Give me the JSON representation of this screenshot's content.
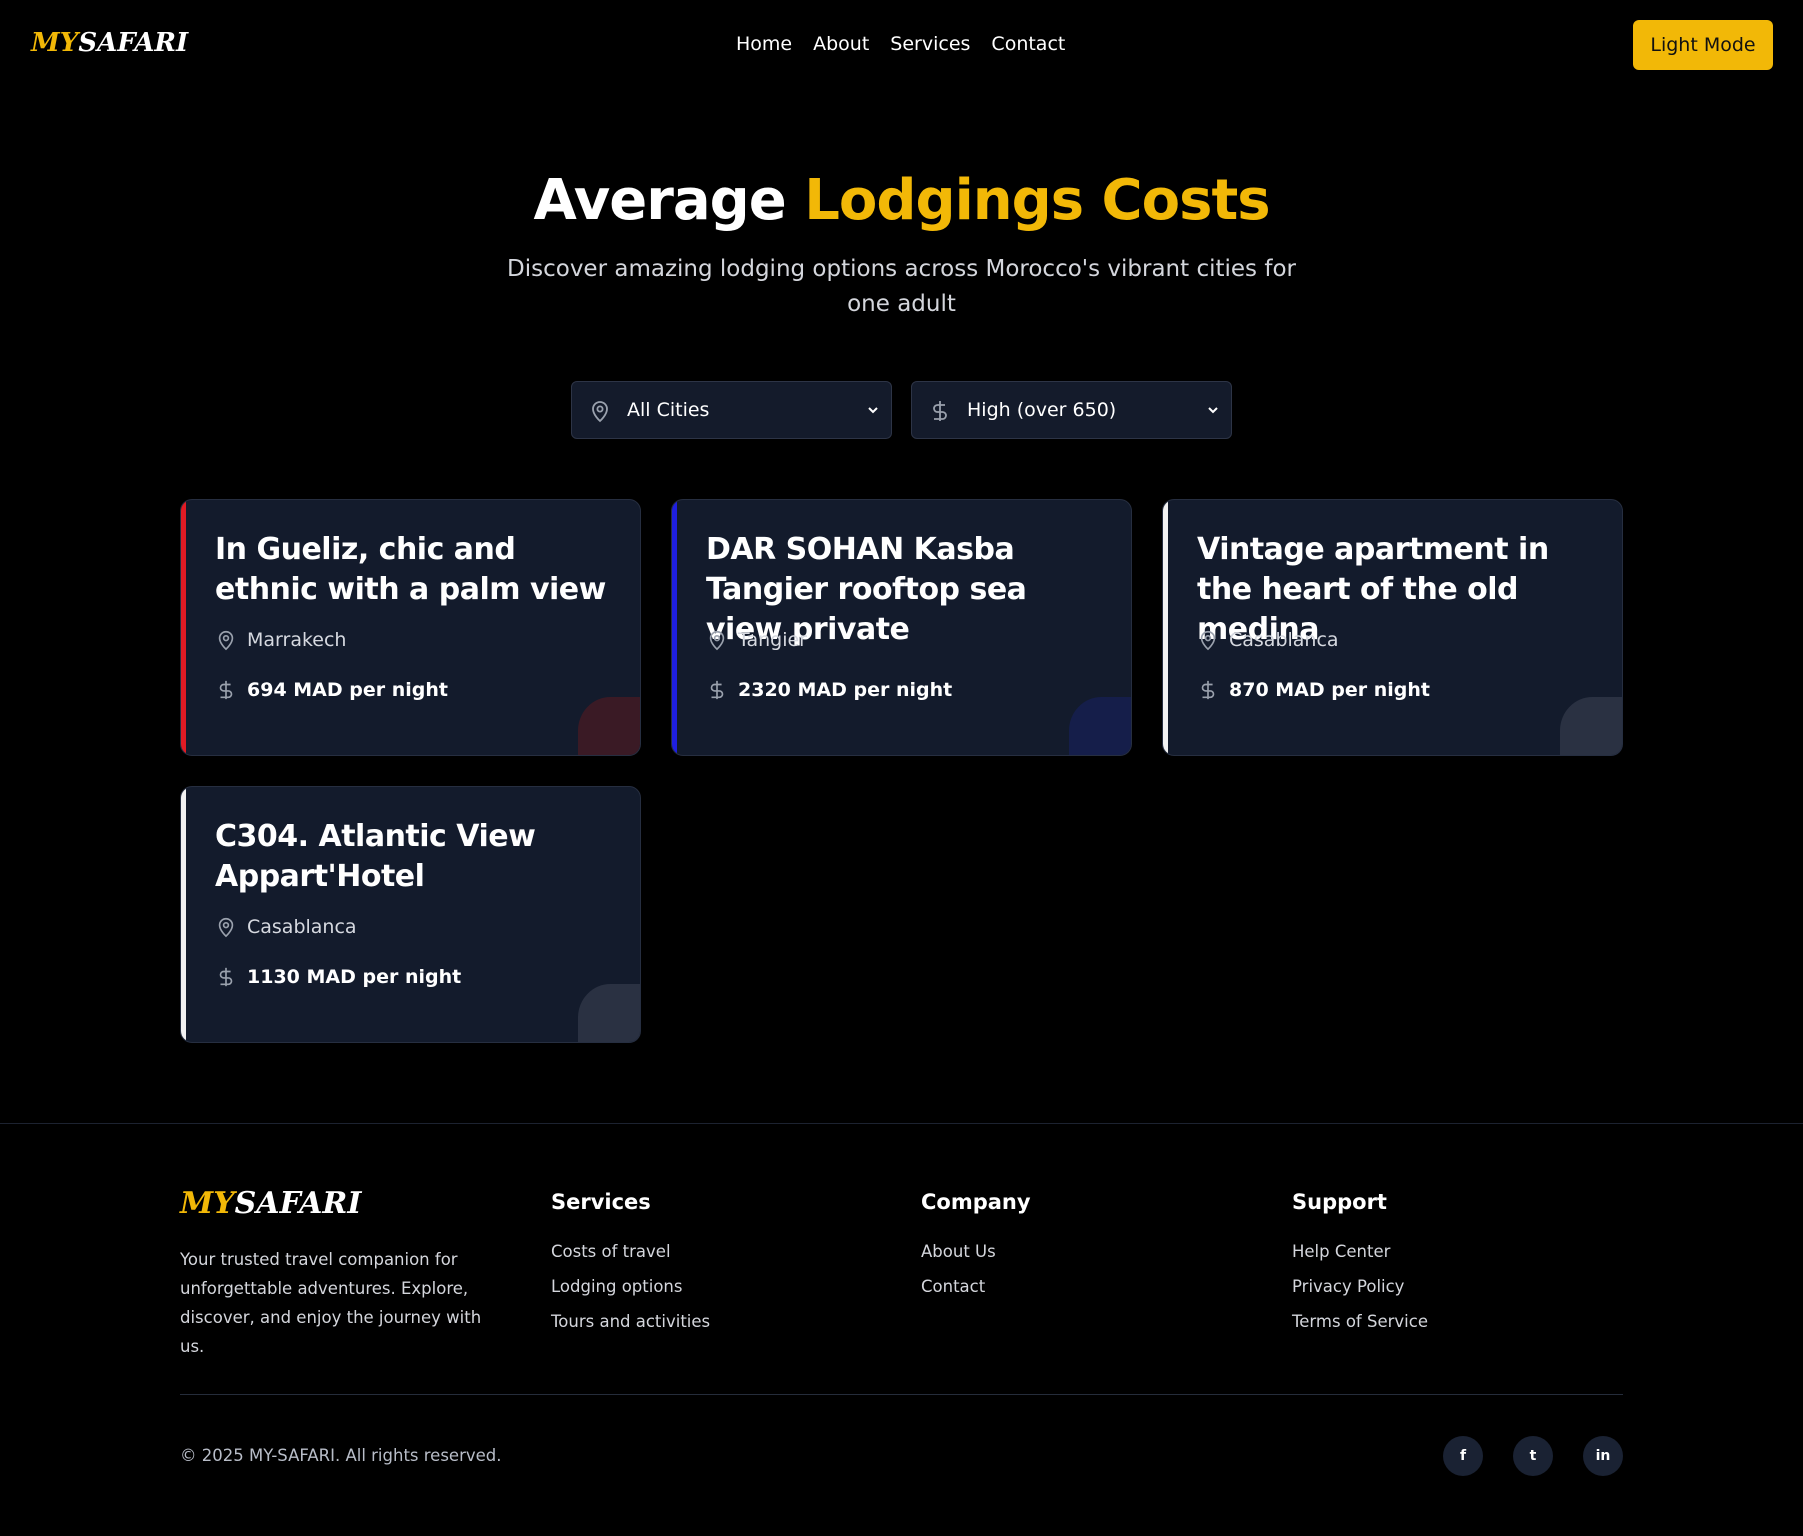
{
  "header": {
    "logo_my": "MY",
    "logo_safari": "SAFARI",
    "nav": [
      "Home",
      "About",
      "Services",
      "Contact"
    ],
    "mode_button": "Light Mode"
  },
  "hero": {
    "title_plain": "Average ",
    "title_accent": "Lodgings Costs",
    "subtitle": "Discover amazing lodging options across Morocco's vibrant cities for one adult"
  },
  "filters": {
    "city": "All Cities",
    "price": "High (over 650)"
  },
  "cards": [
    {
      "title": "In Gueliz, chic and ethnic with a palm view",
      "city": "Marrakech",
      "price": "694 MAD per night",
      "accent": "#e01b24",
      "bubble": "#3a1a25"
    },
    {
      "title": "DAR SOHAN Kasba Tangier rooftop sea view private",
      "city": "Tangier",
      "price": "2320 MAD per night",
      "accent": "#1f1fe0",
      "bubble": "#151e4a"
    },
    {
      "title": "Vintage apartment in the heart of the old medina",
      "city": "Casablanca",
      "price": "870 MAD per night",
      "accent": "#f2f2f2",
      "bubble": "#2a3142"
    },
    {
      "title": "C304. Atlantic View Appart'Hotel",
      "city": "Casablanca",
      "price": "1130 MAD per night",
      "accent": "#f2f2f2",
      "bubble": "#2a3142"
    }
  ],
  "footer": {
    "logo_my": "MY",
    "logo_safari": "SAFARI",
    "description": "Your trusted travel companion for unforgettable adventures. Explore, discover, and enjoy the journey with us.",
    "columns": [
      {
        "heading": "Services",
        "links": [
          "Costs of travel",
          "Lodging options",
          "Tours and activities"
        ]
      },
      {
        "heading": "Company",
        "links": [
          "About Us",
          "Contact"
        ]
      },
      {
        "heading": "Support",
        "links": [
          "Help Center",
          "Privacy Policy",
          "Terms of Service"
        ]
      }
    ],
    "copyright": "© 2025 MY-SAFARI. All rights reserved.",
    "social": [
      "f",
      "t",
      "in"
    ]
  }
}
